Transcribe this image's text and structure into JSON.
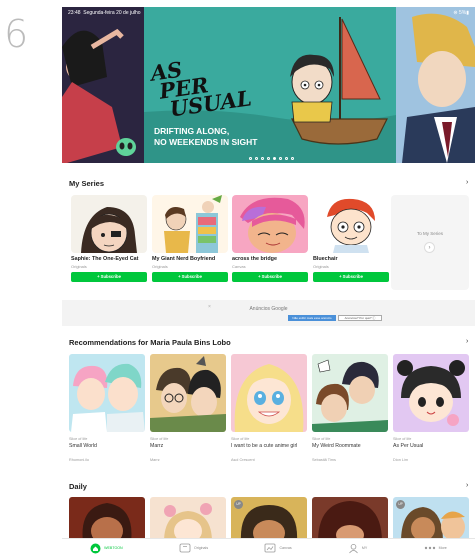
{
  "page_number": "6",
  "status": {
    "time": "23:48",
    "date": "Segunda-feira 20 de julho",
    "battery": "5%"
  },
  "banner": {
    "title_lines": [
      "AS",
      "PER",
      "USUAL"
    ],
    "subtitle_lines": [
      "DRIFTING ALONG,",
      "NO WEEKENDS IN SIGHT"
    ],
    "slide_count": 8,
    "active_slide": 4
  },
  "my_series": {
    "title": "My Series",
    "chevron": "›",
    "items": [
      {
        "title": "Saphie: The One-Eyed Cat",
        "genre": "Originals",
        "subscribe": "+ Subscribe"
      },
      {
        "title": "My Giant Nerd Boyfriend",
        "genre": "Originals",
        "subscribe": "+ Subscribe"
      },
      {
        "title": "across the bridge",
        "genre": "Canvas",
        "subscribe": "+ Subscribe"
      },
      {
        "title": "Bluechair",
        "genre": "Originals",
        "subscribe": "+ Subscribe"
      }
    ],
    "to_my_series": "To My Series",
    "to_my_series_arrow": "›"
  },
  "ad": {
    "label": "Anúncios Google",
    "close": "×",
    "button1": "Não exibir mais esse anúncio",
    "button2": "Anúncios? Por quê? ⓘ"
  },
  "recommendations": {
    "title": "Recommendations for Maria Paula Bins Lobo",
    "chevron": "›",
    "items": [
      {
        "genre": "Slice of life",
        "title": "Small World",
        "author": "Rhomoni.ilo"
      },
      {
        "genre": "Slice of life",
        "title": "Marrz",
        "author": "Marrz"
      },
      {
        "genre": "Slice of life",
        "title": "I want to be a cute anime girl",
        "author": "Asol Crescent"
      },
      {
        "genre": "Slice of life",
        "title": "My Weird Roommate",
        "author": "Sebastiã Tims"
      },
      {
        "genre": "Slice of life",
        "title": "As Per Usual",
        "author": "Dion Lim"
      }
    ]
  },
  "daily": {
    "title": "Daily",
    "chevron": "›",
    "badges": [
      "",
      "",
      "UP",
      "",
      "UP"
    ]
  },
  "bottom_nav": [
    {
      "label": "WEBTOON",
      "icon": "home-icon",
      "active": true
    },
    {
      "label": "Originals",
      "icon": "originals-icon",
      "active": false
    },
    {
      "label": "Canvas",
      "icon": "canvas-icon",
      "active": false
    },
    {
      "label": "MY",
      "icon": "my-icon",
      "active": false
    },
    {
      "label": "More",
      "icon": "more-icon",
      "active": false
    }
  ],
  "colors": {
    "accent": "#00c73c",
    "banner_bg": "#3aaa9e"
  }
}
